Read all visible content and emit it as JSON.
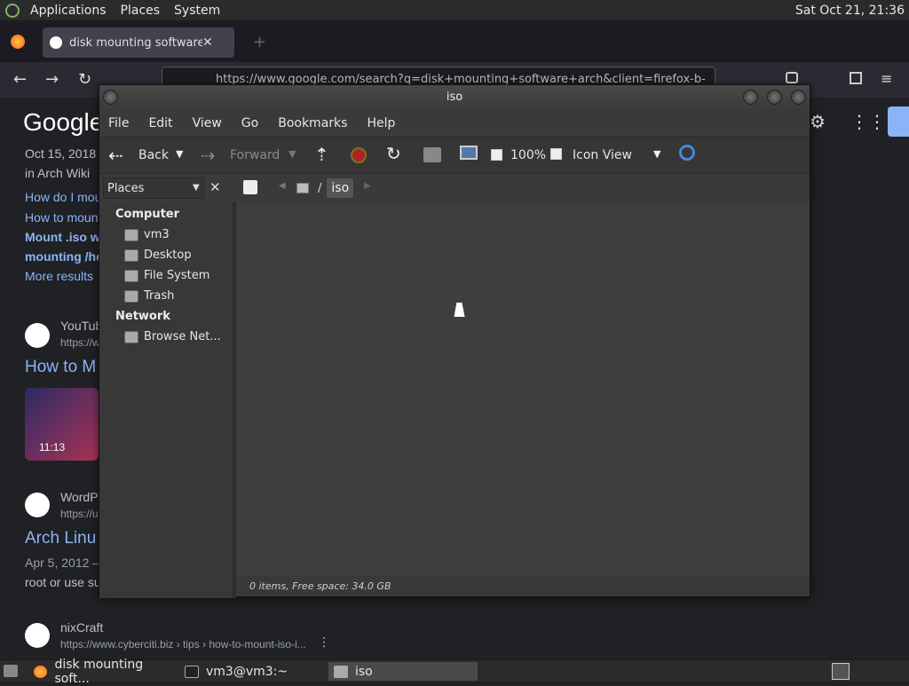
{
  "top_panel": {
    "menus": [
      "Applications",
      "Places",
      "System"
    ],
    "clock": "Sat Oct 21, 21:36"
  },
  "browser": {
    "tab_title": "disk mounting software arch",
    "url": "https://www.google.com/search?q=disk+mounting+software+arch&client=firefox-b-",
    "logo": "Google"
  },
  "google_results": {
    "date1": "Oct 15, 2018",
    "in_arch": "in Arch Wiki",
    "link1": "How do I mou",
    "link2": "How to moun",
    "link3": "Mount .iso w",
    "link4": "mounting /ho",
    "more": "More results",
    "yt_site": "YouTub",
    "yt_url": "https://w",
    "yt_title": "How to M",
    "yt_duration": "11:13",
    "wp_site": "WordP",
    "wp_url": "https://u",
    "wp_title": "Arch Linu",
    "wp_date": "Apr 5, 2012 –",
    "wp_snippet": "root or use su",
    "nix_site": "nixCraft",
    "nix_url": "https://www.cyberciti.biz › tips › how-to-mount-iso-i..."
  },
  "nautilus": {
    "title": "iso",
    "menu": [
      "File",
      "Edit",
      "View",
      "Go",
      "Bookmarks",
      "Help"
    ],
    "toolbar": {
      "back": "Back",
      "forward": "Forward",
      "zoom": "100%",
      "view_mode": "Icon View"
    },
    "location": {
      "root": "/",
      "current": "iso"
    },
    "sidebar": {
      "selector": "Places",
      "computer_heading": "Computer",
      "computer_items": [
        "vm3",
        "Desktop",
        "File System",
        "Trash"
      ],
      "network_heading": "Network",
      "network_items": [
        "Browse Net..."
      ]
    },
    "status": "0 items, Free space: 34.0 GB"
  },
  "taskbar": {
    "tasks": [
      "disk mounting soft...",
      "vm3@vm3:~",
      "iso"
    ]
  }
}
